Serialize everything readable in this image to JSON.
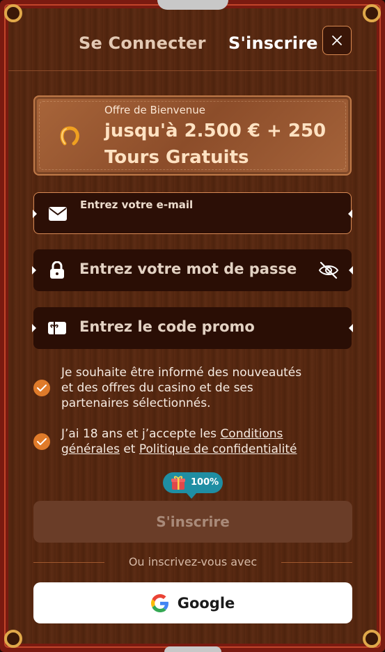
{
  "tabs": {
    "login": "Se Connecter",
    "signup": "S'inscrire"
  },
  "offer": {
    "label": "Offre de Bienvenue",
    "line1": "jusqu'à 2.500 € + 250",
    "line2": "Tours Gratuits"
  },
  "fields": {
    "email_placeholder": "Entrez votre e-mail",
    "password_placeholder": "Entrez votre mot de passe",
    "promo_placeholder": "Entrez le code promo"
  },
  "checks": {
    "newsletter": {
      "line1": "Je souhaite être informé des nouveautés",
      "line2": "et des offres du casino et de ses",
      "line3": "partenaires sélectionnés.",
      "checked": true
    },
    "terms": {
      "prefix": "J’ai 18 ans et j’accepte les ",
      "link1a": "Conditions",
      "link1b": "générales",
      "mid": " et ",
      "link2": "Politique de confidentialité",
      "checked": true
    }
  },
  "badge": {
    "text": "100%"
  },
  "submit_label": "S'inscrire",
  "or_text": "Ou inscrivez-vous avec",
  "google_label": "Google",
  "colors": {
    "accent": "#e07b2a",
    "badge": "#1f8ea3",
    "frame": "#7a1a10"
  }
}
